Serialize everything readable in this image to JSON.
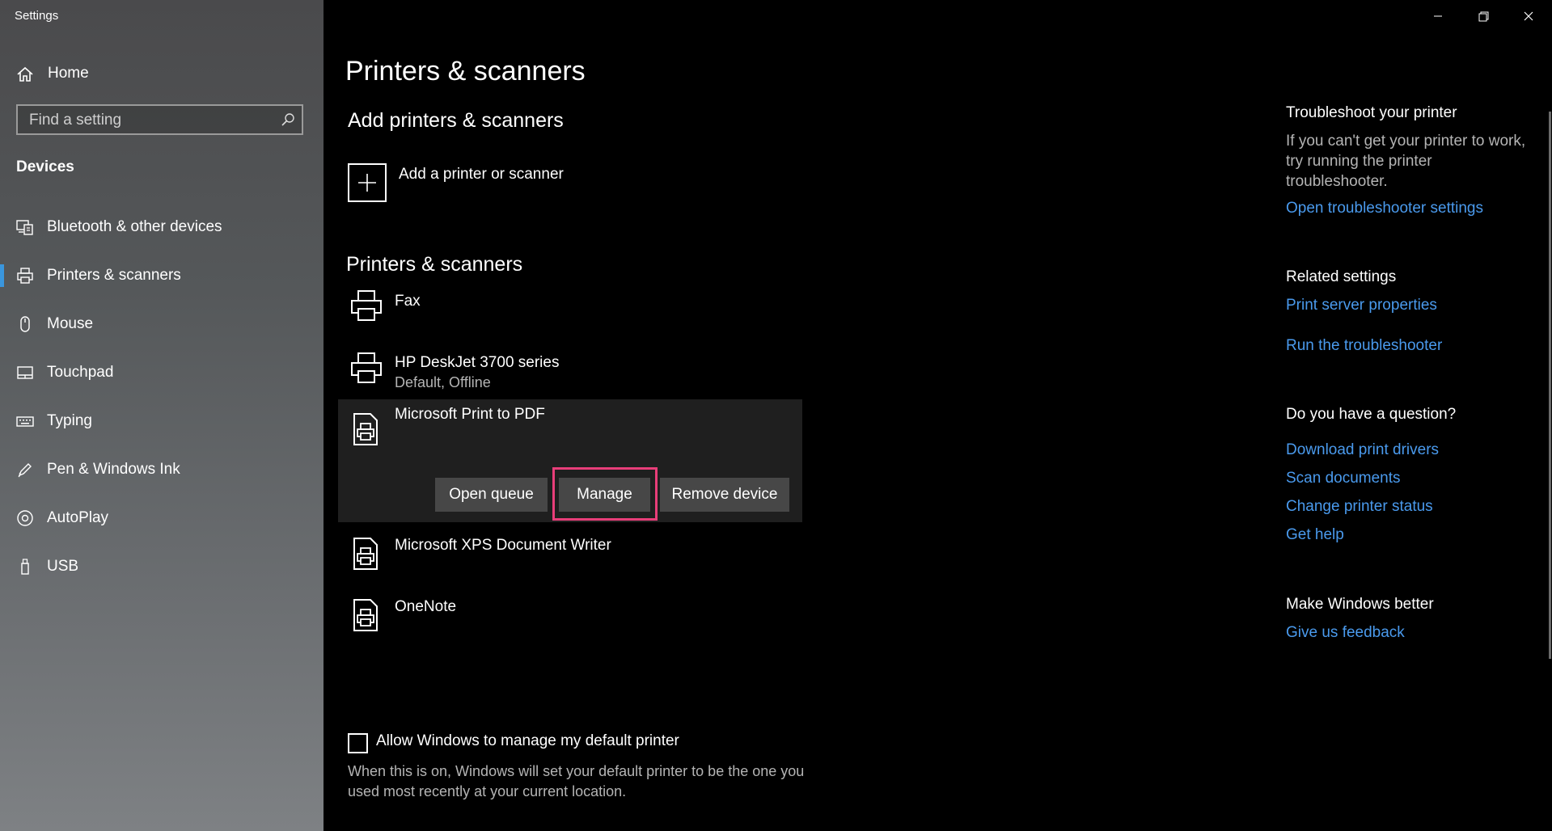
{
  "window": {
    "title": "Settings",
    "controls": {
      "minimize": "minimize-icon",
      "restore": "restore-icon",
      "close": "close-icon"
    }
  },
  "sidebar": {
    "home_label": "Home",
    "search_placeholder": "Find a setting",
    "section_label": "Devices",
    "accent_color": "#3a96dd",
    "items": [
      {
        "label": "Bluetooth & other devices",
        "icon": "bluetooth-devices-icon"
      },
      {
        "label": "Printers & scanners",
        "icon": "printer-icon",
        "active": true
      },
      {
        "label": "Mouse",
        "icon": "mouse-icon"
      },
      {
        "label": "Touchpad",
        "icon": "touchpad-icon"
      },
      {
        "label": "Typing",
        "icon": "keyboard-icon"
      },
      {
        "label": "Pen & Windows Ink",
        "icon": "pen-icon"
      },
      {
        "label": "AutoPlay",
        "icon": "autoplay-icon"
      },
      {
        "label": "USB",
        "icon": "usb-icon"
      }
    ]
  },
  "main": {
    "page_title": "Printers & scanners",
    "add_section_title": "Add printers & scanners",
    "add_button_label": "Add a printer or scanner",
    "devices_section_title": "Printers & scanners",
    "devices": [
      {
        "name": "Fax",
        "status": "",
        "icon": "printer-icon"
      },
      {
        "name": "HP DeskJet 3700 series",
        "status": "Default, Offline",
        "icon": "printer-icon"
      },
      {
        "name": "Microsoft Print to PDF",
        "status": "",
        "icon": "document-printer-icon",
        "selected": true
      },
      {
        "name": "Microsoft XPS Document Writer",
        "status": "",
        "icon": "document-printer-icon"
      },
      {
        "name": "OneNote",
        "status": "",
        "icon": "document-printer-icon"
      }
    ],
    "actions": {
      "open_queue": "Open queue",
      "manage": "Manage",
      "remove_device": "Remove device"
    },
    "highlight_color": "#e83e79",
    "default_printer": {
      "label": "Allow Windows to manage my default printer",
      "checked": false,
      "description": "When this is on, Windows will set your default printer to be the one you used most recently at your current location."
    }
  },
  "related": {
    "troubleshoot_title": "Troubleshoot your printer",
    "troubleshoot_text": "If you can't get your printer to work, try running the printer troubleshooter.",
    "troubleshoot_link": "Open troubleshooter settings",
    "related_title": "Related settings",
    "related_links": [
      "Print server properties",
      "Run the troubleshooter"
    ],
    "question_title": "Do you have a question?",
    "question_links": [
      "Download print drivers",
      "Scan documents",
      "Change printer status",
      "Get help"
    ],
    "better_title": "Make Windows better",
    "better_link": "Give us feedback",
    "link_color": "#4a9aed"
  }
}
